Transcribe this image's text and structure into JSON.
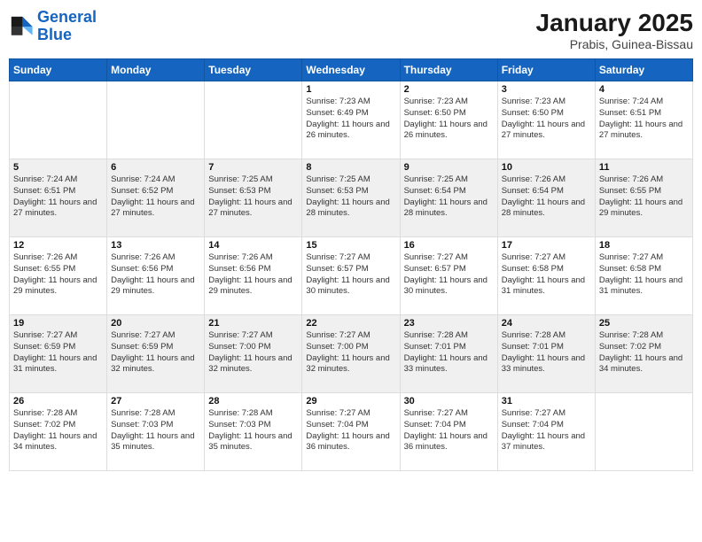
{
  "logo": {
    "line1": "General",
    "line2": "Blue"
  },
  "header": {
    "month": "January 2025",
    "location": "Prabis, Guinea-Bissau"
  },
  "weekdays": [
    "Sunday",
    "Monday",
    "Tuesday",
    "Wednesday",
    "Thursday",
    "Friday",
    "Saturday"
  ],
  "weeks": [
    [
      {
        "num": "",
        "info": ""
      },
      {
        "num": "",
        "info": ""
      },
      {
        "num": "",
        "info": ""
      },
      {
        "num": "1",
        "info": "Sunrise: 7:23 AM\nSunset: 6:49 PM\nDaylight: 11 hours and 26 minutes."
      },
      {
        "num": "2",
        "info": "Sunrise: 7:23 AM\nSunset: 6:50 PM\nDaylight: 11 hours and 26 minutes."
      },
      {
        "num": "3",
        "info": "Sunrise: 7:23 AM\nSunset: 6:50 PM\nDaylight: 11 hours and 27 minutes."
      },
      {
        "num": "4",
        "info": "Sunrise: 7:24 AM\nSunset: 6:51 PM\nDaylight: 11 hours and 27 minutes."
      }
    ],
    [
      {
        "num": "5",
        "info": "Sunrise: 7:24 AM\nSunset: 6:51 PM\nDaylight: 11 hours and 27 minutes."
      },
      {
        "num": "6",
        "info": "Sunrise: 7:24 AM\nSunset: 6:52 PM\nDaylight: 11 hours and 27 minutes."
      },
      {
        "num": "7",
        "info": "Sunrise: 7:25 AM\nSunset: 6:53 PM\nDaylight: 11 hours and 27 minutes."
      },
      {
        "num": "8",
        "info": "Sunrise: 7:25 AM\nSunset: 6:53 PM\nDaylight: 11 hours and 28 minutes."
      },
      {
        "num": "9",
        "info": "Sunrise: 7:25 AM\nSunset: 6:54 PM\nDaylight: 11 hours and 28 minutes."
      },
      {
        "num": "10",
        "info": "Sunrise: 7:26 AM\nSunset: 6:54 PM\nDaylight: 11 hours and 28 minutes."
      },
      {
        "num": "11",
        "info": "Sunrise: 7:26 AM\nSunset: 6:55 PM\nDaylight: 11 hours and 29 minutes."
      }
    ],
    [
      {
        "num": "12",
        "info": "Sunrise: 7:26 AM\nSunset: 6:55 PM\nDaylight: 11 hours and 29 minutes."
      },
      {
        "num": "13",
        "info": "Sunrise: 7:26 AM\nSunset: 6:56 PM\nDaylight: 11 hours and 29 minutes."
      },
      {
        "num": "14",
        "info": "Sunrise: 7:26 AM\nSunset: 6:56 PM\nDaylight: 11 hours and 29 minutes."
      },
      {
        "num": "15",
        "info": "Sunrise: 7:27 AM\nSunset: 6:57 PM\nDaylight: 11 hours and 30 minutes."
      },
      {
        "num": "16",
        "info": "Sunrise: 7:27 AM\nSunset: 6:57 PM\nDaylight: 11 hours and 30 minutes."
      },
      {
        "num": "17",
        "info": "Sunrise: 7:27 AM\nSunset: 6:58 PM\nDaylight: 11 hours and 31 minutes."
      },
      {
        "num": "18",
        "info": "Sunrise: 7:27 AM\nSunset: 6:58 PM\nDaylight: 11 hours and 31 minutes."
      }
    ],
    [
      {
        "num": "19",
        "info": "Sunrise: 7:27 AM\nSunset: 6:59 PM\nDaylight: 11 hours and 31 minutes."
      },
      {
        "num": "20",
        "info": "Sunrise: 7:27 AM\nSunset: 6:59 PM\nDaylight: 11 hours and 32 minutes."
      },
      {
        "num": "21",
        "info": "Sunrise: 7:27 AM\nSunset: 7:00 PM\nDaylight: 11 hours and 32 minutes."
      },
      {
        "num": "22",
        "info": "Sunrise: 7:27 AM\nSunset: 7:00 PM\nDaylight: 11 hours and 32 minutes."
      },
      {
        "num": "23",
        "info": "Sunrise: 7:28 AM\nSunset: 7:01 PM\nDaylight: 11 hours and 33 minutes."
      },
      {
        "num": "24",
        "info": "Sunrise: 7:28 AM\nSunset: 7:01 PM\nDaylight: 11 hours and 33 minutes."
      },
      {
        "num": "25",
        "info": "Sunrise: 7:28 AM\nSunset: 7:02 PM\nDaylight: 11 hours and 34 minutes."
      }
    ],
    [
      {
        "num": "26",
        "info": "Sunrise: 7:28 AM\nSunset: 7:02 PM\nDaylight: 11 hours and 34 minutes."
      },
      {
        "num": "27",
        "info": "Sunrise: 7:28 AM\nSunset: 7:03 PM\nDaylight: 11 hours and 35 minutes."
      },
      {
        "num": "28",
        "info": "Sunrise: 7:28 AM\nSunset: 7:03 PM\nDaylight: 11 hours and 35 minutes."
      },
      {
        "num": "29",
        "info": "Sunrise: 7:27 AM\nSunset: 7:04 PM\nDaylight: 11 hours and 36 minutes."
      },
      {
        "num": "30",
        "info": "Sunrise: 7:27 AM\nSunset: 7:04 PM\nDaylight: 11 hours and 36 minutes."
      },
      {
        "num": "31",
        "info": "Sunrise: 7:27 AM\nSunset: 7:04 PM\nDaylight: 11 hours and 37 minutes."
      },
      {
        "num": "",
        "info": ""
      }
    ]
  ]
}
